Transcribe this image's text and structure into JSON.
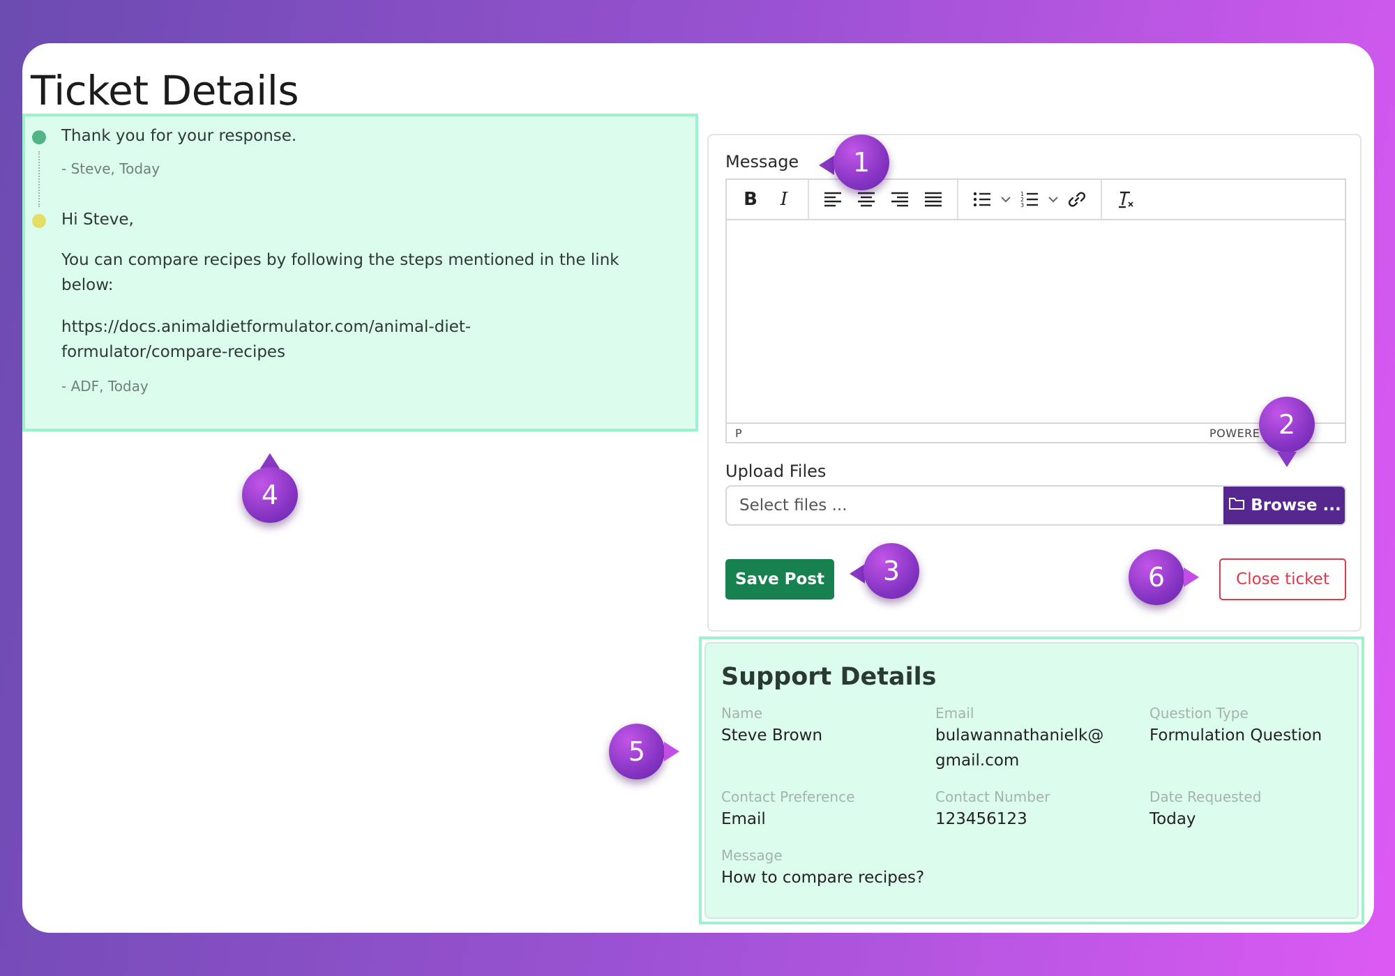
{
  "page": {
    "title": "Ticket Details"
  },
  "thread": {
    "messages": [
      {
        "body": [
          "Thank you for your response."
        ],
        "author": "- Steve, Today",
        "status": "green"
      },
      {
        "body": [
          "Hi Steve,",
          "You can compare recipes by following the steps mentioned in the link below:",
          "https://docs.animaldietformulator.com/animal-diet-formulator/compare-recipes"
        ],
        "author": "- ADF, Today",
        "status": "yellow"
      }
    ]
  },
  "form": {
    "message_label": "Message",
    "editor": {
      "toolbar": [
        "bold-icon",
        "italic-icon",
        "align-left-icon",
        "align-center-icon",
        "align-right-icon",
        "align-justify-icon",
        "bullet-list-icon",
        "numbered-list-icon",
        "link-icon",
        "clear-format-icon"
      ],
      "status_path": "P",
      "status_powered": "POWERE Y"
    },
    "upload_label": "Upload Files",
    "upload_placeholder": "Select files ...",
    "browse_label": "Browse ...",
    "save_label": "Save Post",
    "close_label": "Close ticket"
  },
  "support": {
    "title": "Support Details",
    "fields": [
      {
        "label": "Name",
        "value": "Steve Brown"
      },
      {
        "label": "Email",
        "value": "bulawannathanielk@ gmail.com"
      },
      {
        "label": "Question Type",
        "value": "Formulation Question"
      },
      {
        "label": "Contact Preference",
        "value": "Email"
      },
      {
        "label": "Contact Number",
        "value": "123456123"
      },
      {
        "label": "Date Requested",
        "value": "Today"
      },
      {
        "label": "Message",
        "value": "How to compare recipes?"
      }
    ]
  },
  "callouts": [
    "1",
    "2",
    "3",
    "4",
    "5",
    "6"
  ],
  "colors": {
    "accent": "#55278f",
    "save": "#17814f",
    "danger": "#de3a4a",
    "highlight": "#dcfdee"
  }
}
